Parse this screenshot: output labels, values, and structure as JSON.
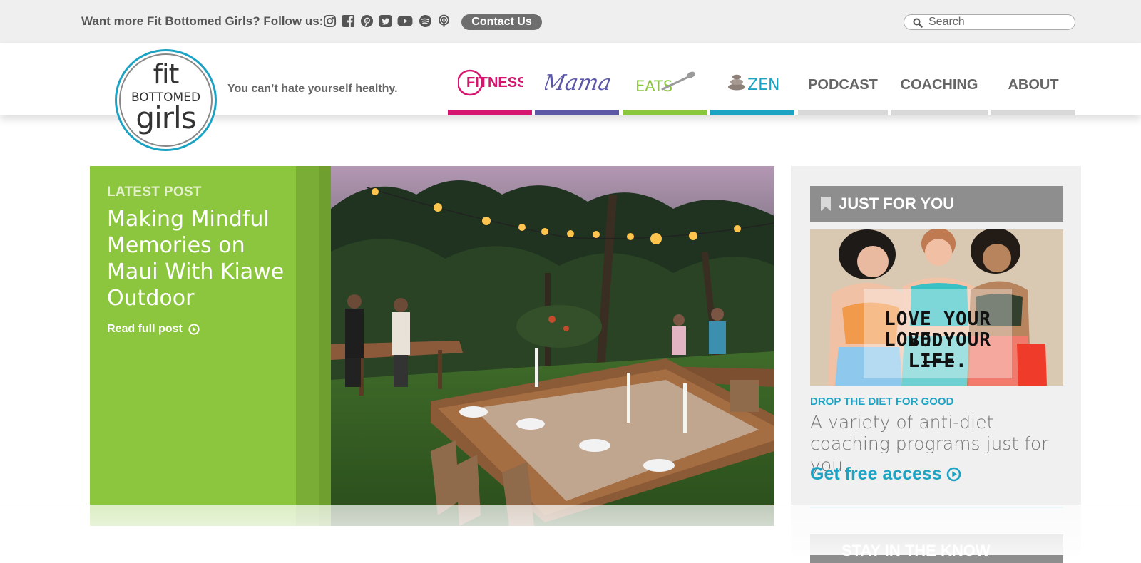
{
  "topbar": {
    "follow_text": "Want more Fit Bottomed Girls? Follow us:",
    "social_icons": [
      "instagram-icon",
      "facebook-icon",
      "pinterest-icon",
      "twitter-icon",
      "youtube-icon",
      "spotify-icon",
      "podcast-icon"
    ],
    "contact_label": "Contact Us",
    "search_placeholder": "Search"
  },
  "logo": {
    "line1": "fit",
    "line2": "BOTTOMED",
    "line3": "girls",
    "ring_color": "#1ca3c3"
  },
  "tagline": "You can’t hate yourself healthy.",
  "nav": {
    "fitness": "FITNESS",
    "mamas": "Mamas",
    "eats": "EATS",
    "zen": "ZEN",
    "podcast": "PODCAST",
    "coaching": "COACHING",
    "about": "ABOUT",
    "colors": {
      "fitness": "#d6156e",
      "mamas": "#5c58a6",
      "eats": "#8cc63f",
      "zen": "#1ca3c3",
      "neutral": "#d8d8d8"
    }
  },
  "latest": {
    "label": "LATEST POST",
    "title": "Making Mindful Memories on Maui With Kiawe Outdoor",
    "read_more": "Read full post",
    "accent": "#8cc63f"
  },
  "sidebar": {
    "heading": "JUST FOR YOU",
    "promo_line1": "LOVE YOUR BODY.",
    "promo_line2": "LOVE YOUR LIFE.",
    "drop_label": "DROP THE DIET FOR GOOD",
    "drop_desc": "A variety of anti-diet coaching programs just for you.",
    "cta": "Get free access",
    "stay_heading": "STAY IN THE KNOW",
    "accent": "#1ca3c3"
  }
}
